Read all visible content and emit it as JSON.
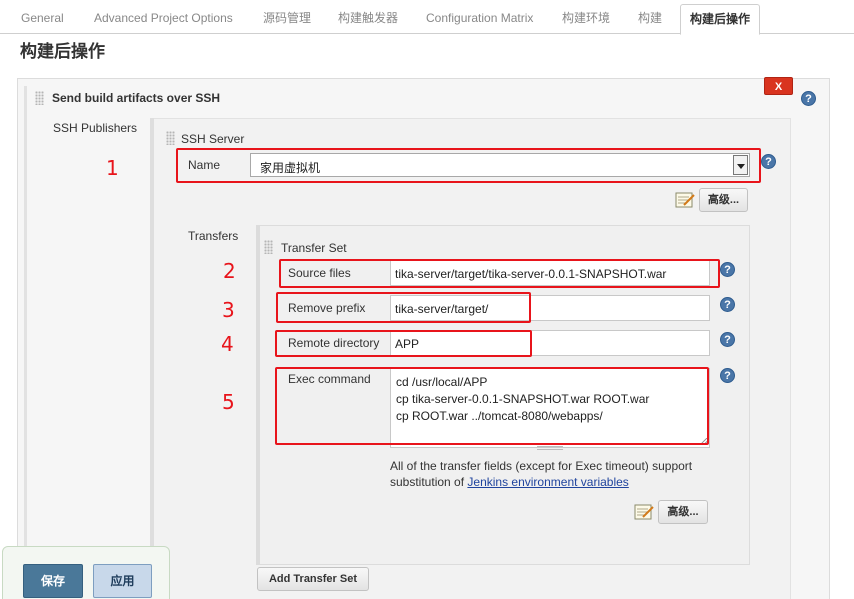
{
  "tabs": [
    {
      "label": "General"
    },
    {
      "label": "Advanced Project Options"
    },
    {
      "label": "源码管理"
    },
    {
      "label": "构建触发器"
    },
    {
      "label": "Configuration Matrix"
    },
    {
      "label": "构建环境"
    },
    {
      "label": "构建"
    },
    {
      "label": "构建后操作"
    }
  ],
  "section_title": "构建后操作",
  "step": {
    "title": "Send build artifacts over SSH",
    "delete_label": "X",
    "publishers_label": "SSH Publishers",
    "server_label": "SSH Server",
    "name_label": "Name",
    "name_value": "家用虚拟机",
    "advanced_label": "高级...",
    "transfers_label": "Transfers",
    "transfer_set_label": "Transfer Set",
    "fields": {
      "source_files_label": "Source files",
      "source_files_value": "tika-server/target/tika-server-0.0.1-SNAPSHOT.war",
      "remove_prefix_label": "Remove prefix",
      "remove_prefix_value": "tika-server/target/",
      "remote_directory_label": "Remote directory",
      "remote_directory_value": "APP",
      "exec_command_label": "Exec command",
      "exec_command_lines": [
        "cd /usr/local/APP",
        "cp tika-server-0.0.1-SNAPSHOT.war ROOT.war",
        "cp ROOT.war ../tomcat-8080/webapps/"
      ]
    },
    "info_text_prefix": "All of the transfer fields (except for Exec timeout) support substitution of ",
    "info_link": "Jenkins environment variables",
    "transfer_advanced_label": "高级...",
    "add_transfer_set_label": "Add Transfer Set"
  },
  "annotations": [
    "1",
    "2",
    "3",
    "4",
    "5"
  ],
  "footer": {
    "save_label": "保存",
    "apply_label": "应用"
  },
  "colors": {
    "annotation_red": "#e8141b",
    "delete_red": "#d9341f",
    "save_blue": "#4a7899",
    "link_blue": "#20449e"
  },
  "icons": [
    "help-icon",
    "notepad-icon",
    "drag-handle-icon",
    "dropdown-arrow-icon"
  ]
}
